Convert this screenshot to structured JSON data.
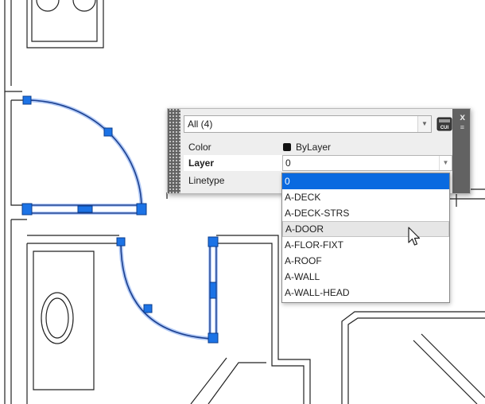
{
  "quick_properties": {
    "selection_filter": "All (4)",
    "properties": [
      {
        "label": "Color",
        "value": "ByLayer"
      },
      {
        "label": "Layer",
        "value": "0"
      },
      {
        "label": "Linetype",
        "value": ""
      }
    ],
    "icons": {
      "close": "close-icon",
      "options": "options-icon",
      "customize": "cui-icon"
    },
    "close_glyph": "x",
    "customize_label": "CUI",
    "layer_dropdown": {
      "items": [
        "0",
        "A-DECK",
        "A-DECK-STRS",
        "A-DOOR",
        "A-FLOR-FIXT",
        "A-ROOF",
        "A-WALL",
        "A-WALL-HEAD"
      ],
      "selected_index": 0,
      "hover_index": 3
    }
  },
  "colors": {
    "selection_blue": "#0a6ae0",
    "grip_blue": "#1c73e6",
    "selection_glow": "#7ea6f2"
  }
}
